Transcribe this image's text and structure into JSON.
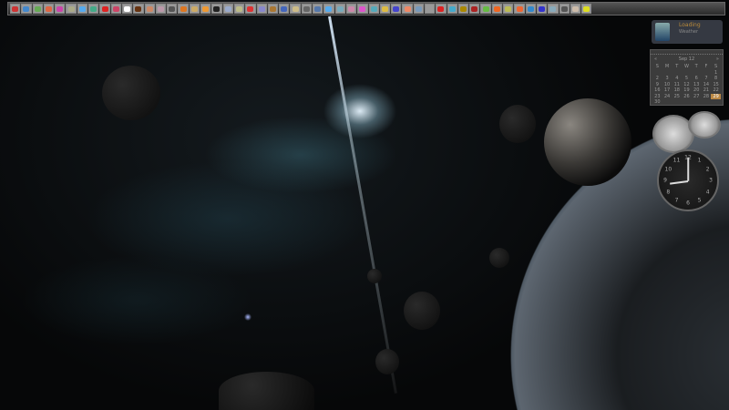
{
  "toolbar": {
    "icon_colors": [
      "#c33",
      "#48c",
      "#6a5",
      "#d64",
      "#c4a",
      "#aa8",
      "#5ae",
      "#4a8",
      "#d22",
      "#c46",
      "#fff",
      "#631",
      "#c86",
      "#b9a",
      "#555",
      "#d72",
      "#ca6",
      "#e93",
      "#222",
      "#9ac",
      "#bb8",
      "#d33",
      "#88c",
      "#a73",
      "#46b",
      "#cb8",
      "#666",
      "#57a",
      "#5ae",
      "#7ab",
      "#c8a",
      "#d5c",
      "#5ab",
      "#db4",
      "#44c",
      "#e86",
      "#79b",
      "#999",
      "#d22",
      "#4ac",
      "#a80",
      "#a22",
      "#6b4",
      "#e62",
      "#bb5",
      "#e63",
      "#38c",
      "#33c",
      "#8ab",
      "#555",
      "#cba",
      "#dd2"
    ]
  },
  "weather": {
    "temp": "Loading",
    "location": "Weather"
  },
  "calendar": {
    "month": "Sep 12",
    "prev": "«",
    "next": "»",
    "weekdays": [
      "S",
      "M",
      "T",
      "W",
      "T",
      "F",
      "S"
    ],
    "days": [
      "",
      "",
      "",
      "",
      "",
      "",
      "1",
      "2",
      "3",
      "4",
      "5",
      "6",
      "7",
      "8",
      "9",
      "10",
      "11",
      "12",
      "13",
      "14",
      "15",
      "16",
      "17",
      "18",
      "19",
      "20",
      "21",
      "22",
      "23",
      "24",
      "25",
      "26",
      "27",
      "28",
      "29",
      "30"
    ],
    "today": "29"
  },
  "clock": {
    "numbers": [
      "12",
      "1",
      "2",
      "3",
      "4",
      "5",
      "6",
      "7",
      "8",
      "9",
      "10",
      "11"
    ],
    "hour": 8.75,
    "minute": 0
  }
}
